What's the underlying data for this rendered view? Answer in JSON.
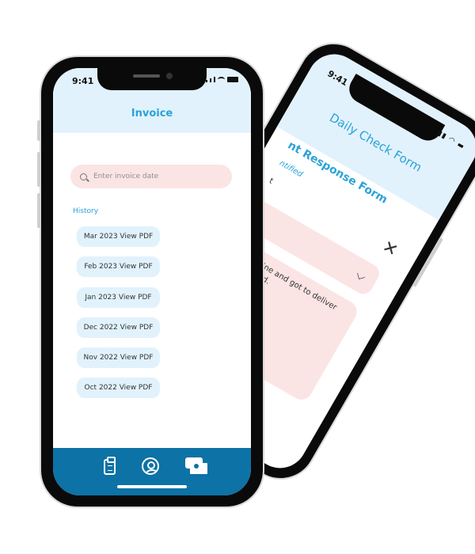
{
  "back_phone": {
    "time": "9:41",
    "title": "Daily Check Form",
    "subtitle": "nt Response Form",
    "field_label": "ntified",
    "field_value": "t",
    "description_text": "yellow line and got to deliver my last ad."
  },
  "front_phone": {
    "time": "9:41",
    "title": "Invoice",
    "search": {
      "placeholder": "Enter invoice date"
    },
    "history_label": "History",
    "history_items": [
      "Mar 2023 View PDF",
      "Feb 2023 View PDF",
      "Jan 2023 View PDF",
      "Dec 2022 View PDF",
      "Nov 2022 View PDF",
      "Oct 2022 View PDF"
    ],
    "bottom_nav": [
      "clipboard-icon",
      "user-profile-icon",
      "money-icon"
    ]
  },
  "colors": {
    "accent": "#2aa3d8",
    "header_bg": "#e1f2fc",
    "search_bg": "#fbe4e4",
    "bottom_nav_bg": "#0d72a6"
  }
}
